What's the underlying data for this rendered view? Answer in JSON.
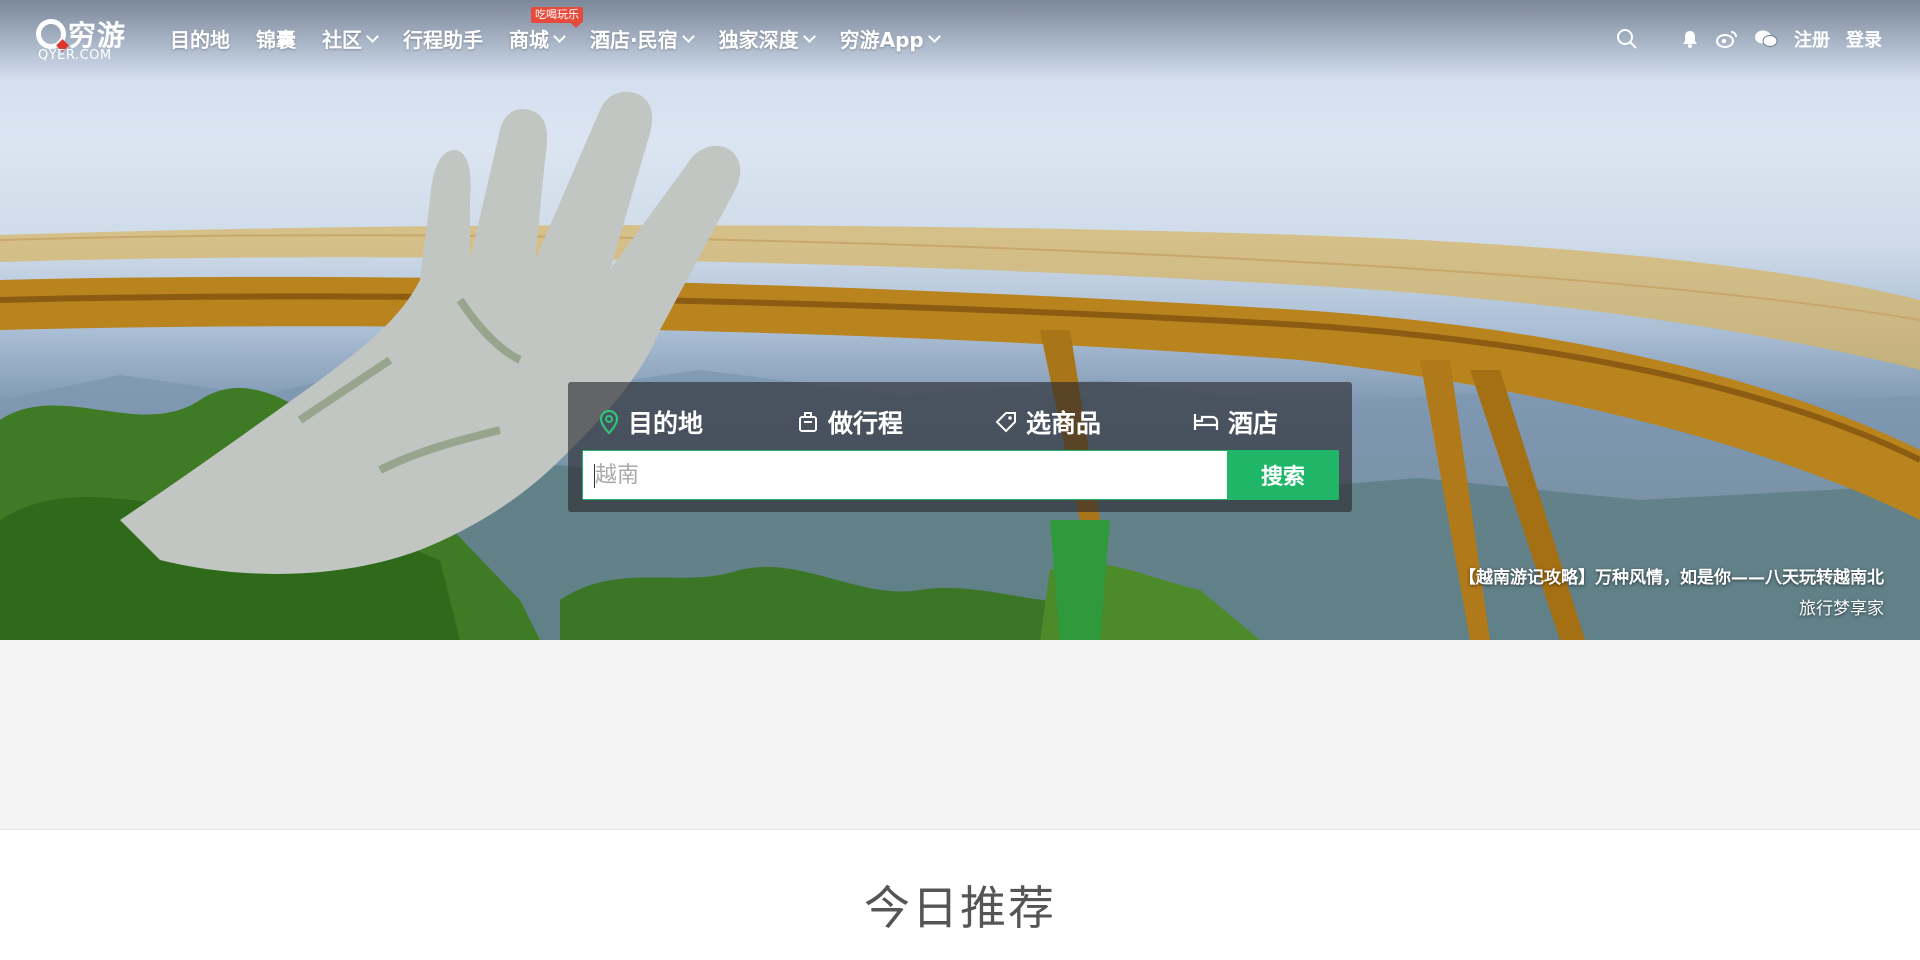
{
  "nav": {
    "logo_text": "穷游",
    "logo_sub": "QYER.COM",
    "items": [
      {
        "label": "目的地",
        "dropdown": false
      },
      {
        "label": "锦囊",
        "dropdown": false
      },
      {
        "label": "社区",
        "dropdown": true
      },
      {
        "label": "行程助手",
        "dropdown": false
      },
      {
        "label": "商城",
        "dropdown": true,
        "badge": "吃喝玩乐"
      },
      {
        "label": "酒店·民宿",
        "dropdown": true
      },
      {
        "label": "独家深度",
        "dropdown": true
      },
      {
        "label": "穷游App",
        "dropdown": true
      }
    ],
    "right": {
      "icons": [
        "search-icon",
        "bell-icon",
        "weibo-icon",
        "wechat-icon"
      ],
      "register": "注册",
      "login": "登录"
    }
  },
  "search": {
    "tabs": [
      {
        "label": "目的地",
        "icon": "location-pin-icon",
        "active": true
      },
      {
        "label": "做行程",
        "icon": "luggage-icon",
        "active": false
      },
      {
        "label": "选商品",
        "icon": "tag-icon",
        "active": false
      },
      {
        "label": "酒店",
        "icon": "bed-icon",
        "active": false
      }
    ],
    "placeholder": "越南",
    "value": "",
    "button": "搜索"
  },
  "hero": {
    "caption_title": "【越南游记攻略】万种风情，如是你——八天玩转越南北",
    "caption_author": "旅行梦享家"
  },
  "section": {
    "title": "今日推荐"
  },
  "colors": {
    "accent": "#1fb767",
    "badge": "#e64a3b",
    "band": "#f4f4f4"
  }
}
